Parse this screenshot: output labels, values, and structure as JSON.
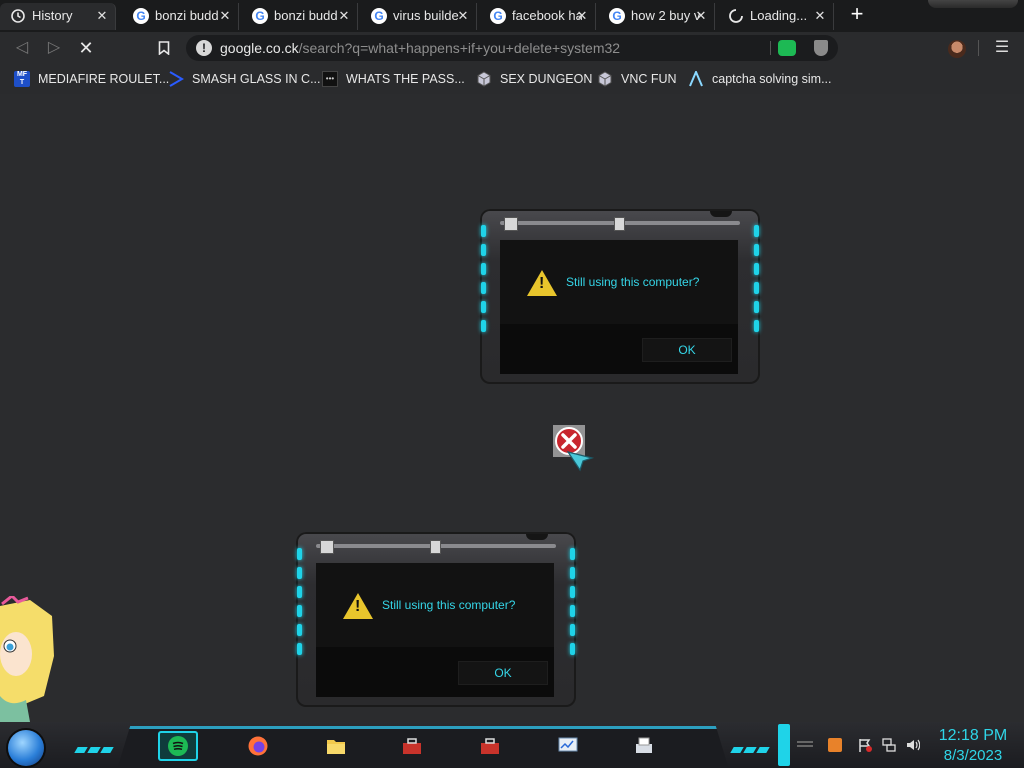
{
  "browser": {
    "tabs": [
      {
        "label": "History",
        "icon": "history-icon",
        "active": true
      },
      {
        "label": "bonzi budd",
        "icon": "google-icon"
      },
      {
        "label": "bonzi budd",
        "icon": "google-icon"
      },
      {
        "label": "virus builde",
        "icon": "google-icon"
      },
      {
        "label": "facebook ha",
        "icon": "google-icon"
      },
      {
        "label": "how 2 buy v",
        "icon": "google-icon"
      },
      {
        "label": "Loading...",
        "icon": "loading-spinner-icon"
      }
    ],
    "tab_close": "✕",
    "new_tab": "+",
    "toolbar": {
      "back": "◁",
      "forward": "▷",
      "stop": "✕",
      "bookmark_star": "bookmark-icon",
      "url_domain": "google.co.ck",
      "url_path": "/search?q=what+happens+if+you+delete+system32",
      "menu": "☰"
    },
    "bookmarks": [
      {
        "label": "MEDIAFIRE ROULET...",
        "icon": "mediafire-icon"
      },
      {
        "label": "SMASH GLASS IN C...",
        "icon": "chevron-icon"
      },
      {
        "label": "WHATS THE PASS...",
        "icon": "password-icon"
      },
      {
        "label": "SEX DUNGEON",
        "icon": "cube-icon"
      },
      {
        "label": "VNC FUN",
        "icon": "cube-icon"
      },
      {
        "label": "captcha solving sim...",
        "icon": "caret-icon"
      }
    ]
  },
  "dialogs": [
    {
      "message": "Still using this computer?",
      "ok": "OK"
    },
    {
      "message": "Still using this computer?",
      "ok": "OK"
    }
  ],
  "taskbar": {
    "apps": [
      {
        "name": "spotify"
      },
      {
        "name": "firefox"
      },
      {
        "name": "file-explorer"
      },
      {
        "name": "toolbox"
      },
      {
        "name": "toolbox"
      },
      {
        "name": "system-monitor"
      },
      {
        "name": "printer"
      }
    ],
    "clock": {
      "time": "12:18 PM",
      "date": "8/3/2023"
    }
  },
  "colors": {
    "accent": "#1fd3e8",
    "text_cyan": "#35d6e8",
    "warning": "#e8c52c"
  }
}
